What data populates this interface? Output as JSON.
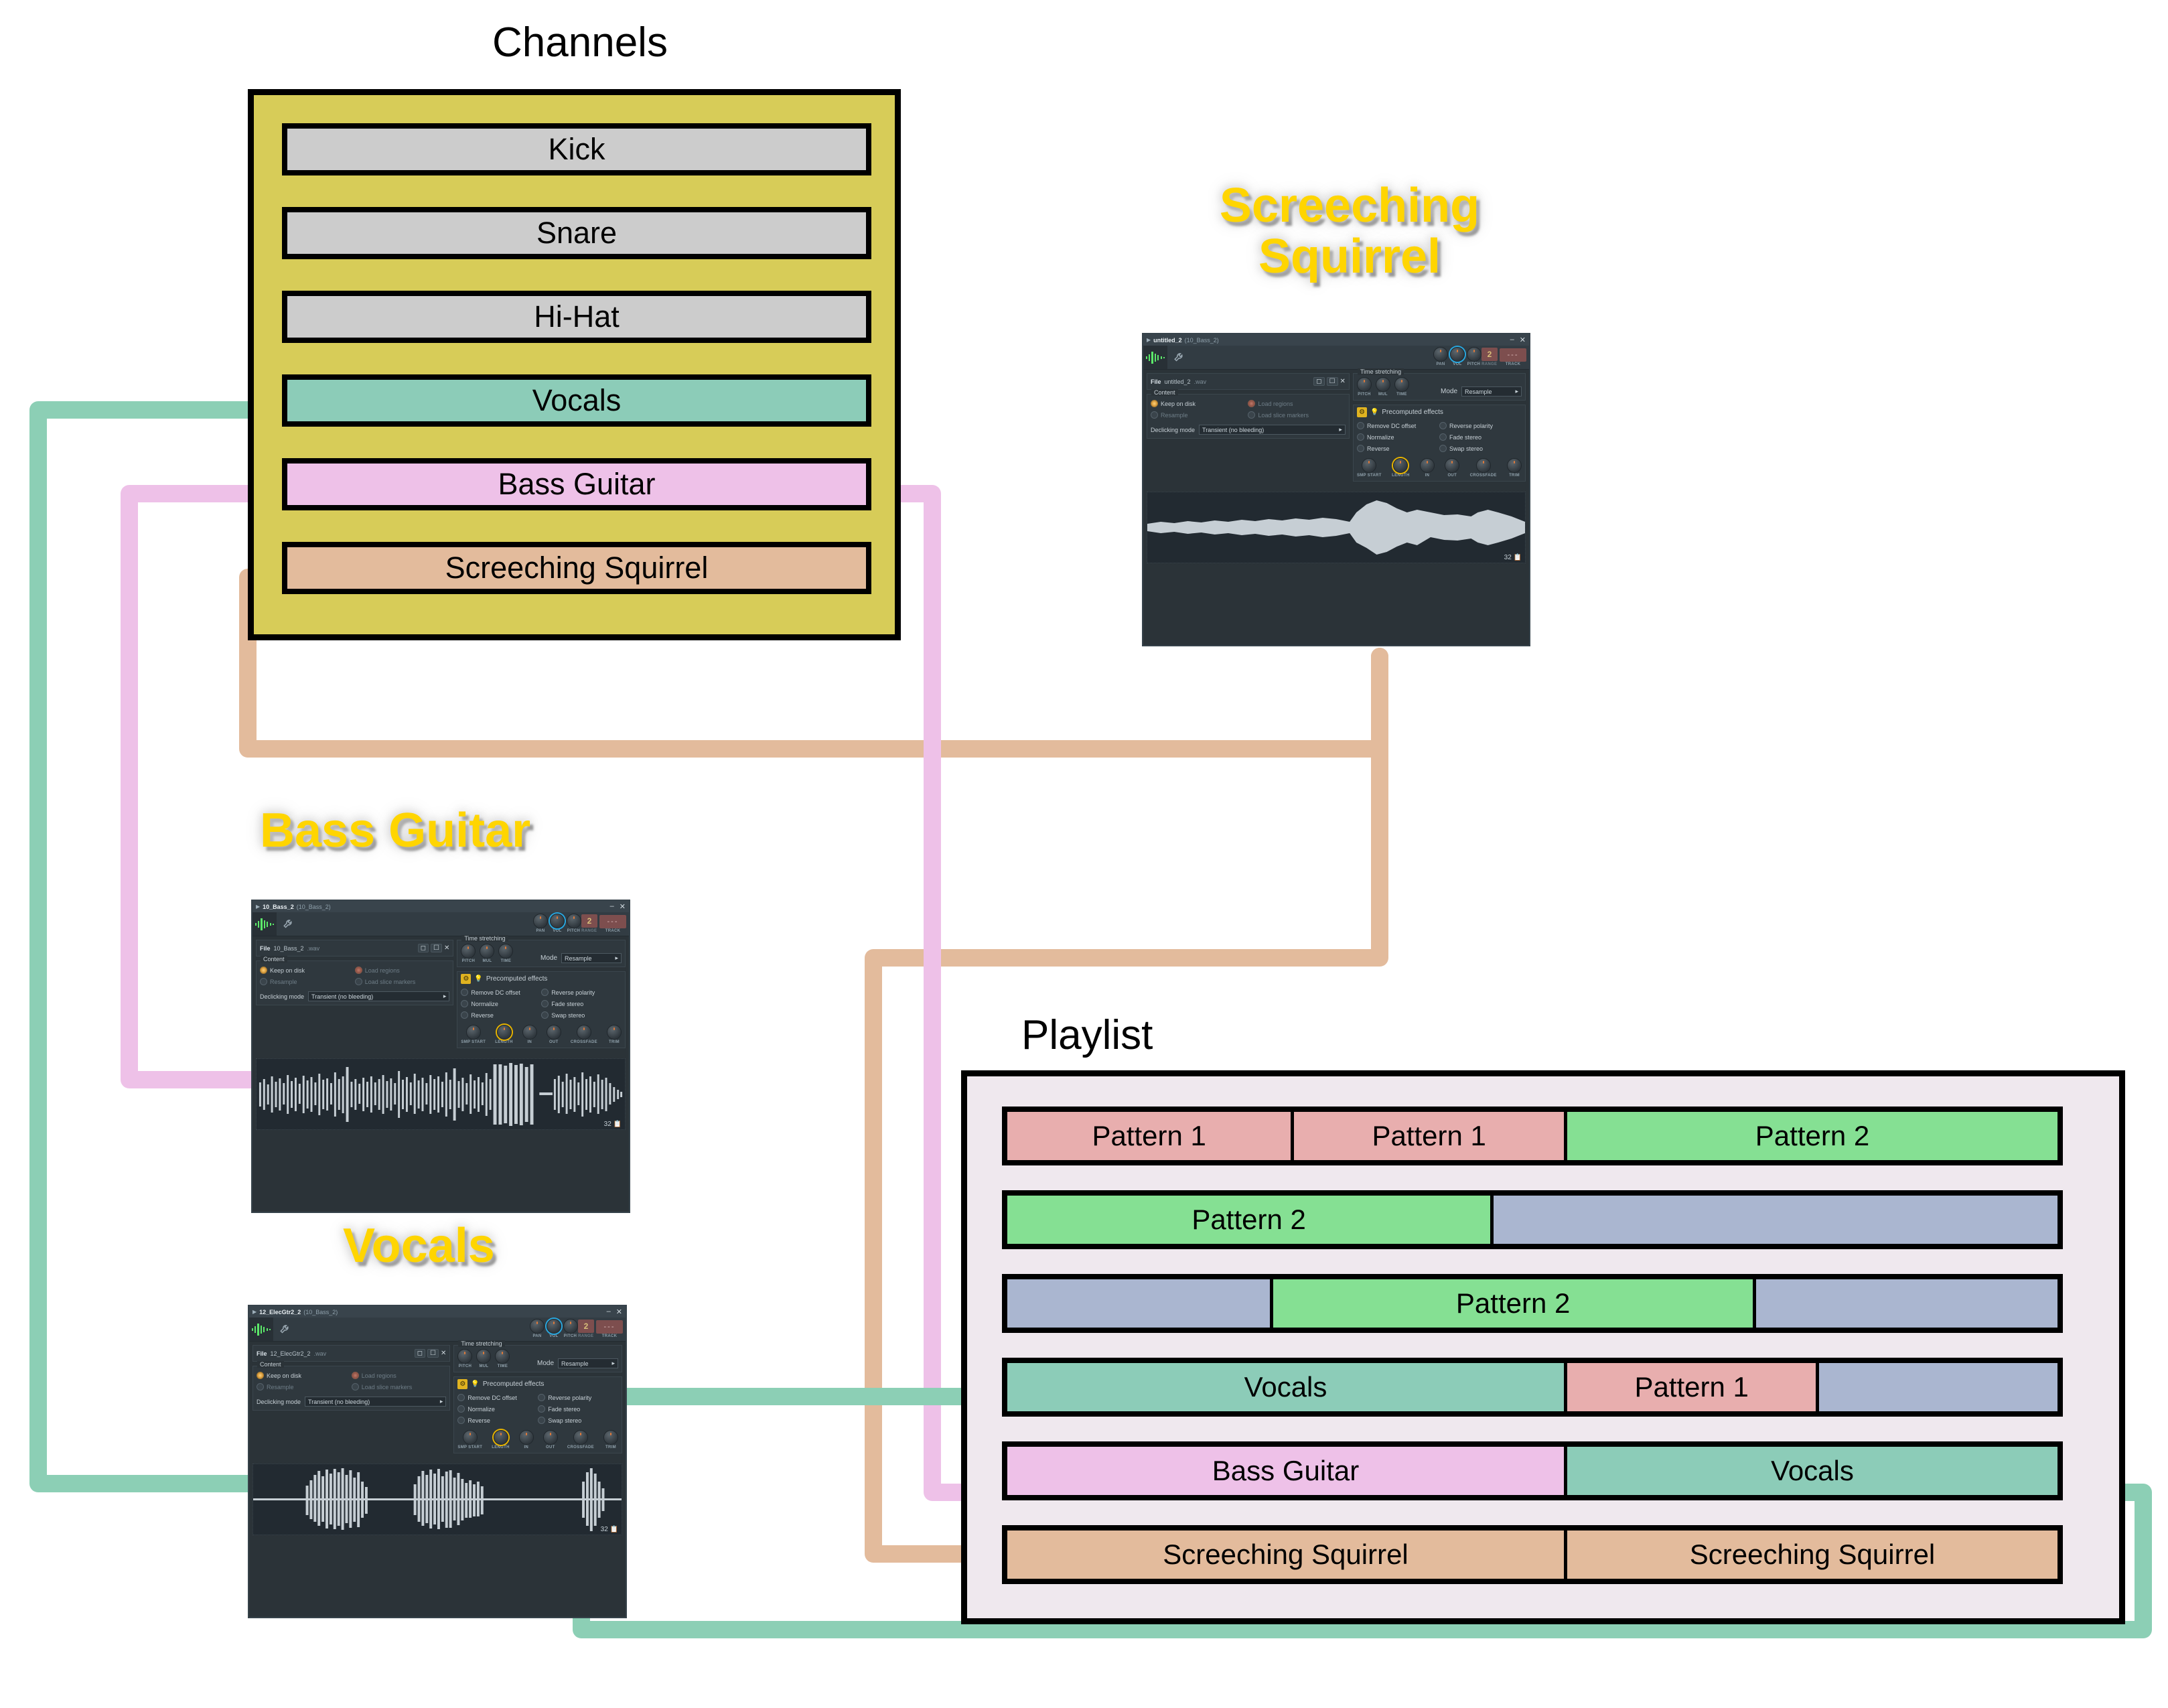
{
  "channels": {
    "title": "Channels",
    "panel_color": "#d7cc58",
    "items": [
      {
        "label": "Kick",
        "color": "#cccccc"
      },
      {
        "label": "Snare",
        "color": "#cccccc"
      },
      {
        "label": "Hi-Hat",
        "color": "#cccccc"
      },
      {
        "label": "Vocals",
        "color": "#8cccb8"
      },
      {
        "label": "Bass Guitar",
        "color": "#eec1e8"
      },
      {
        "label": "Screeching Squirrel",
        "color": "#e3bb9c"
      }
    ]
  },
  "playlist": {
    "title": "Playlist",
    "panel_color": "#efe8ee",
    "rows": [
      {
        "clips": [
          {
            "label": "Pattern 1",
            "color": "#e8aeae",
            "width": 27
          },
          {
            "label": "Pattern 1",
            "color": "#e8aeae",
            "width": 26
          },
          {
            "label": "Pattern 2",
            "color": "#85e093",
            "width": 47
          }
        ]
      },
      {
        "clips": [
          {
            "label": "Pattern 2",
            "color": "#85e093",
            "width": 46
          },
          {
            "label": "",
            "color": "#aab6d0",
            "width": 54
          }
        ]
      },
      {
        "clips": [
          {
            "label": "",
            "color": "#aab6d0",
            "width": 25
          },
          {
            "label": "Pattern 2",
            "color": "#85e093",
            "width": 46
          },
          {
            "label": "",
            "color": "#aab6d0",
            "width": 29
          }
        ]
      },
      {
        "clips": [
          {
            "label": "Vocals",
            "color": "#8cccb8",
            "width": 53
          },
          {
            "label": "Pattern 1",
            "color": "#e8aeae",
            "width": 24
          },
          {
            "label": "",
            "color": "#aab6d0",
            "width": 23
          }
        ]
      },
      {
        "clips": [
          {
            "label": "Bass Guitar",
            "color": "#eec1e8",
            "width": 53
          },
          {
            "label": "Vocals",
            "color": "#8cccb8",
            "width": 47
          }
        ]
      },
      {
        "clips": [
          {
            "label": "Screeching Squirrel",
            "color": "#e3bb9c",
            "width": 53
          },
          {
            "label": "Screeching Squirrel",
            "color": "#e3bb9c",
            "width": 47
          }
        ]
      }
    ]
  },
  "neon_labels": {
    "squirrel": "Screeching\nSquirrel",
    "squirrel_line1": "Screeching",
    "squirrel_line2": "Squirrel",
    "bass": "Bass Guitar",
    "vocals": "Vocals",
    "color": "#ffd500"
  },
  "samplers": [
    {
      "id": "squirrel",
      "titlebar": {
        "name": "untitled_2",
        "sub": "(10_Bass_2)",
        "expand_icon": "triangle-right-icon",
        "minimize": "–",
        "close": "✕"
      },
      "header": {
        "tabs": [
          "waveform-icon",
          "wrench-icon"
        ],
        "knobs": [
          {
            "label": "PAN"
          },
          {
            "label": "VOL"
          },
          {
            "label": "PITCH"
          }
        ],
        "range_label": "RANGE",
        "pitch_value": "2",
        "track_label": "TRACK",
        "track_value": "---"
      },
      "file": {
        "label": "File",
        "value": "untitled_2",
        "ext": ".wav",
        "buttons": [
          "folder-icon",
          "save-icon",
          "close-icon"
        ]
      },
      "content": {
        "legend": "Content",
        "options": [
          {
            "label": "Keep on disk",
            "state": "on"
          },
          {
            "label": "Load regions",
            "state": "red"
          },
          {
            "label": "Resample",
            "state": "off"
          },
          {
            "label": "Load slice markers",
            "state": "off"
          }
        ],
        "declick_label": "Declicking mode",
        "declick_value": "Transient (no bleeding)"
      },
      "time_stretching": {
        "legend": "Time stretching",
        "knobs": [
          "PITCH",
          "MUL",
          "TIME"
        ],
        "mode_label": "Mode",
        "mode_value": "Resample"
      },
      "precomputed": {
        "legend": "Precomputed effects",
        "checks": [
          "Remove DC offset",
          "Reverse polarity",
          "Normalize",
          "Fade stereo",
          "Reverse",
          "Swap stereo"
        ],
        "knobs": [
          "SMP START",
          "LENGTH",
          "IN",
          "OUT",
          "CROSSFADE",
          "TRIM"
        ]
      },
      "wave": {
        "count": "32",
        "icon": "clipboard-icon",
        "shape": "squirrel"
      }
    },
    {
      "id": "bass",
      "titlebar": {
        "name": "10_Bass_2",
        "sub": "(10_Bass_2)",
        "expand_icon": "triangle-right-icon",
        "minimize": "–",
        "close": "✕"
      },
      "header": {
        "tabs": [
          "waveform-icon",
          "wrench-icon"
        ],
        "knobs": [
          {
            "label": "PAN"
          },
          {
            "label": "VOL"
          },
          {
            "label": "PITCH"
          }
        ],
        "range_label": "RANGE",
        "pitch_value": "2",
        "track_label": "TRACK",
        "track_value": "---"
      },
      "file": {
        "label": "File",
        "value": "10_Bass_2",
        "ext": ".wav",
        "buttons": [
          "folder-icon",
          "save-icon",
          "close-icon"
        ]
      },
      "content": {
        "legend": "Content",
        "options": [
          {
            "label": "Keep on disk",
            "state": "on"
          },
          {
            "label": "Load regions",
            "state": "red"
          },
          {
            "label": "Resample",
            "state": "off"
          },
          {
            "label": "Load slice markers",
            "state": "off"
          }
        ],
        "declick_label": "Declicking mode",
        "declick_value": "Transient (no bleeding)"
      },
      "time_stretching": {
        "legend": "Time stretching",
        "knobs": [
          "PITCH",
          "MUL",
          "TIME"
        ],
        "mode_label": "Mode",
        "mode_value": "Resample"
      },
      "precomputed": {
        "legend": "Precomputed effects",
        "checks": [
          "Remove DC offset",
          "Reverse polarity",
          "Normalize",
          "Fade stereo",
          "Reverse",
          "Swap stereo"
        ],
        "knobs": [
          "SMP START",
          "LENGTH",
          "IN",
          "OUT",
          "CROSSFADE",
          "TRIM"
        ]
      },
      "wave": {
        "count": "32",
        "icon": "clipboard-icon",
        "shape": "bass"
      }
    },
    {
      "id": "vocals",
      "titlebar": {
        "name": "12_ElecGtr2_2",
        "sub": "(10_Bass_2)",
        "expand_icon": "triangle-right-icon",
        "minimize": "–",
        "close": "✕"
      },
      "header": {
        "tabs": [
          "waveform-icon",
          "wrench-icon"
        ],
        "knobs": [
          {
            "label": "PAN"
          },
          {
            "label": "VOL"
          },
          {
            "label": "PITCH"
          }
        ],
        "range_label": "RANGE",
        "pitch_value": "2",
        "track_label": "TRACK",
        "track_value": "---"
      },
      "file": {
        "label": "File",
        "value": "12_ElecGtr2_2",
        "ext": ".wav",
        "buttons": [
          "folder-icon",
          "save-icon",
          "close-icon"
        ]
      },
      "content": {
        "legend": "Content",
        "options": [
          {
            "label": "Keep on disk",
            "state": "on"
          },
          {
            "label": "Load regions",
            "state": "red"
          },
          {
            "label": "Resample",
            "state": "off"
          },
          {
            "label": "Load slice markers",
            "state": "off"
          }
        ],
        "declick_label": "Declicking mode",
        "declick_value": "Transient (no bleeding)"
      },
      "time_stretching": {
        "legend": "Time stretching",
        "knobs": [
          "PITCH",
          "MUL",
          "TIME"
        ],
        "mode_label": "Mode",
        "mode_value": "Resample"
      },
      "precomputed": {
        "legend": "Precomputed effects",
        "checks": [
          "Remove DC offset",
          "Reverse polarity",
          "Normalize",
          "Fade stereo",
          "Reverse",
          "Swap stereo"
        ],
        "knobs": [
          "SMP START",
          "LENGTH",
          "IN",
          "OUT",
          "CROSSFADE",
          "TRIM"
        ]
      },
      "wave": {
        "count": "32",
        "icon": "clipboard-icon",
        "shape": "vocals"
      }
    }
  ],
  "connectors": [
    {
      "name": "vocals-wire",
      "color": "#8ccfb5"
    },
    {
      "name": "bass-wire",
      "color": "#eec1e8"
    },
    {
      "name": "squirrel-wire",
      "color": "#e3bb9c"
    }
  ]
}
